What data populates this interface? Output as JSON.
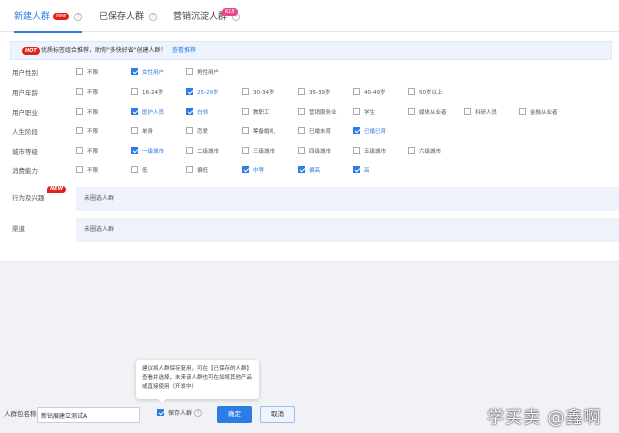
{
  "tabs": [
    {
      "label": "新建人群",
      "badge": "new",
      "active": true
    },
    {
      "label": "已保存人群",
      "active": false
    },
    {
      "label": "营销沉淀人群",
      "badge": "618",
      "active": false
    }
  ],
  "notice": {
    "hot": "HOT",
    "text": "优质标签组合推荐，助你\"多快好省\"创建人群！",
    "link": "查看推荐"
  },
  "filters": [
    {
      "label": "用户性别",
      "options": [
        {
          "label": "不限",
          "checked": false
        },
        {
          "label": "女性用户",
          "checked": true
        },
        {
          "label": "男性用户",
          "checked": false
        }
      ]
    },
    {
      "label": "用户年龄",
      "options": [
        {
          "label": "不限",
          "checked": false
        },
        {
          "label": "18-24岁",
          "checked": false
        },
        {
          "label": "25-29岁",
          "checked": true
        },
        {
          "label": "30-34岁",
          "checked": false
        },
        {
          "label": "35-39岁",
          "checked": false
        },
        {
          "label": "40-49岁",
          "checked": false
        },
        {
          "label": "50岁以上",
          "checked": false
        }
      ]
    },
    {
      "label": "用户职业",
      "options": [
        {
          "label": "不限",
          "checked": false
        },
        {
          "label": "医护人员",
          "checked": true
        },
        {
          "label": "白领",
          "checked": true
        },
        {
          "label": "教职工",
          "checked": false
        },
        {
          "label": "营销服务业",
          "checked": false
        },
        {
          "label": "学生",
          "checked": false
        },
        {
          "label": "媒体从业者",
          "checked": false
        },
        {
          "label": "科研人员",
          "checked": false
        },
        {
          "label": "金融从业者",
          "checked": false
        }
      ]
    },
    {
      "label": "人生阶段",
      "options": [
        {
          "label": "不限",
          "checked": false
        },
        {
          "label": "单身",
          "checked": false
        },
        {
          "label": "恋爱",
          "checked": false
        },
        {
          "label": "筹备婚礼",
          "checked": false
        },
        {
          "label": "已婚未育",
          "checked": false
        },
        {
          "label": "已婚已育",
          "checked": true
        }
      ]
    },
    {
      "label": "城市等级",
      "options": [
        {
          "label": "不限",
          "checked": false
        },
        {
          "label": "一级城市",
          "checked": true
        },
        {
          "label": "二级城市",
          "checked": false
        },
        {
          "label": "三级城市",
          "checked": false
        },
        {
          "label": "四级城市",
          "checked": false
        },
        {
          "label": "五级城市",
          "checked": false
        },
        {
          "label": "六级城市",
          "checked": false
        }
      ]
    },
    {
      "label": "消费能力",
      "options": [
        {
          "label": "不限",
          "checked": false
        },
        {
          "label": "低",
          "checked": false
        },
        {
          "label": "偏低",
          "checked": false
        },
        {
          "label": "中等",
          "checked": true
        },
        {
          "label": "偏高",
          "checked": true
        },
        {
          "label": "高",
          "checked": true
        }
      ]
    }
  ],
  "behavior": {
    "label": "行为及兴趣",
    "badge": "NEW",
    "value": "未圈选人群"
  },
  "channel": {
    "label": "渠道",
    "value": "未圈选人群"
  },
  "tooltip": {
    "text": "建议将人群保存复用，可在【已保存的人群】查看并选择，未来该人群也可在如将其他产品或直接使用（开发中）"
  },
  "bottom": {
    "name_label": "人群包名称",
    "name_value": "新钻展建立测试A",
    "save_label": "保存人群",
    "ok_label": "确定",
    "cancel_label": "取消"
  },
  "watermark": "学买卖 @鑫啊"
}
